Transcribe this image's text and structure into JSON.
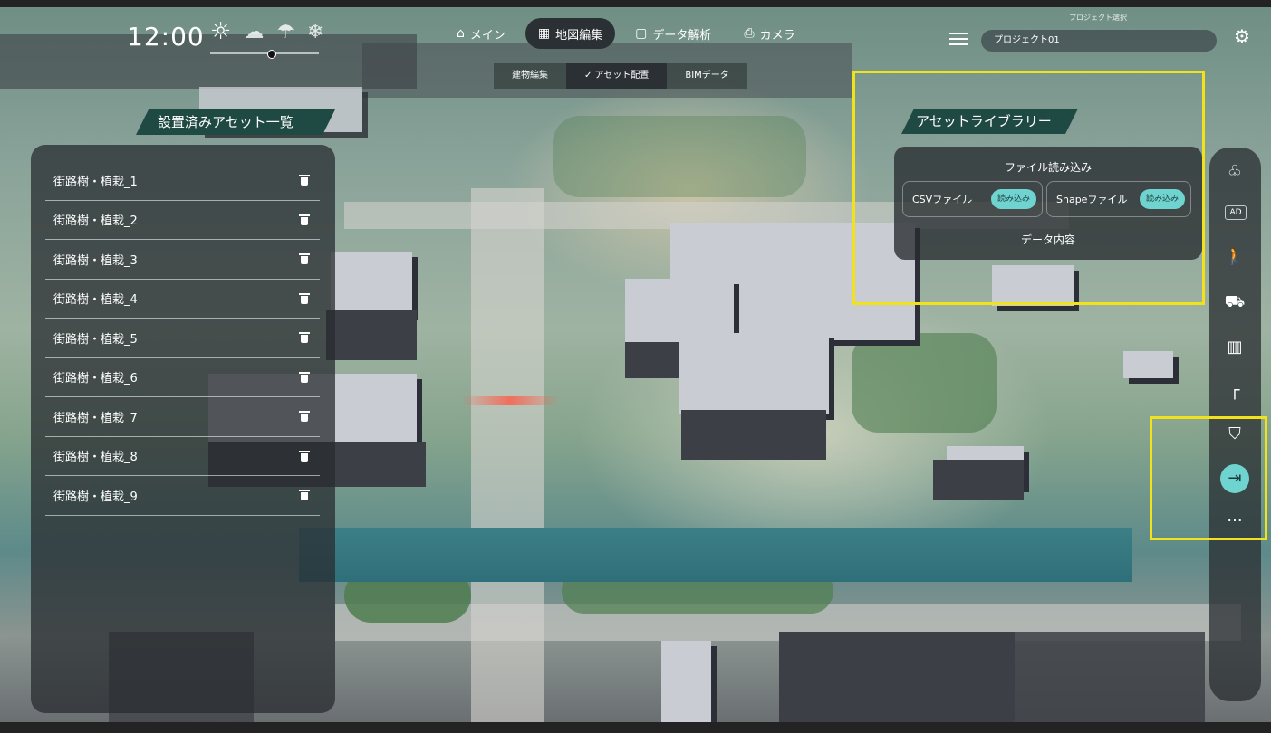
{
  "time": "12:00",
  "weather": {
    "sun_icon": "sun-icon",
    "cloud_icon": "cloud-icon",
    "umbrella_icon": "umbrella-icon",
    "snow_icon": "snowflake-icon"
  },
  "nav": {
    "tabs": [
      {
        "label": "メイン",
        "icon": "home-icon"
      },
      {
        "label": "地図編集",
        "icon": "building-icon"
      },
      {
        "label": "データ解析",
        "icon": "square-icon"
      },
      {
        "label": "カメラ",
        "icon": "camera-icon"
      }
    ],
    "active_index": 1
  },
  "subtabs": [
    "建物編集",
    "✓ アセット配置",
    "BIMデータ"
  ],
  "project": {
    "label": "プロジェクト選択",
    "value": "プロジェクト01"
  },
  "asset_panel": {
    "title": "設置済みアセット一覧",
    "items": [
      "街路樹・植栽_1",
      "街路樹・植栽_2",
      "街路樹・植栽_3",
      "街路樹・植栽_4",
      "街路樹・植栽_5",
      "街路樹・植栽_6",
      "街路樹・植栽_7",
      "街路樹・植栽_8",
      "街路樹・植栽_9"
    ]
  },
  "library": {
    "title": "アセットライブラリー",
    "file_heading": "ファイル読み込み",
    "csv_label": "CSVファイル",
    "shape_label": "Shapeファイル",
    "load_label": "読み込み",
    "data_heading": "データ内容"
  },
  "side_toolbar": {
    "icons": [
      "tree-icon",
      "ad-icon",
      "person-icon",
      "car-icon",
      "building-icon",
      "streetlight-icon",
      "warning-shield-icon",
      "import-icon",
      "more-icon"
    ],
    "ad_text": "AD",
    "more_text": "···"
  },
  "colors": {
    "accent": "#6fd3d0",
    "panel_title": "#1f4a43",
    "highlight": "#f2e21b"
  }
}
